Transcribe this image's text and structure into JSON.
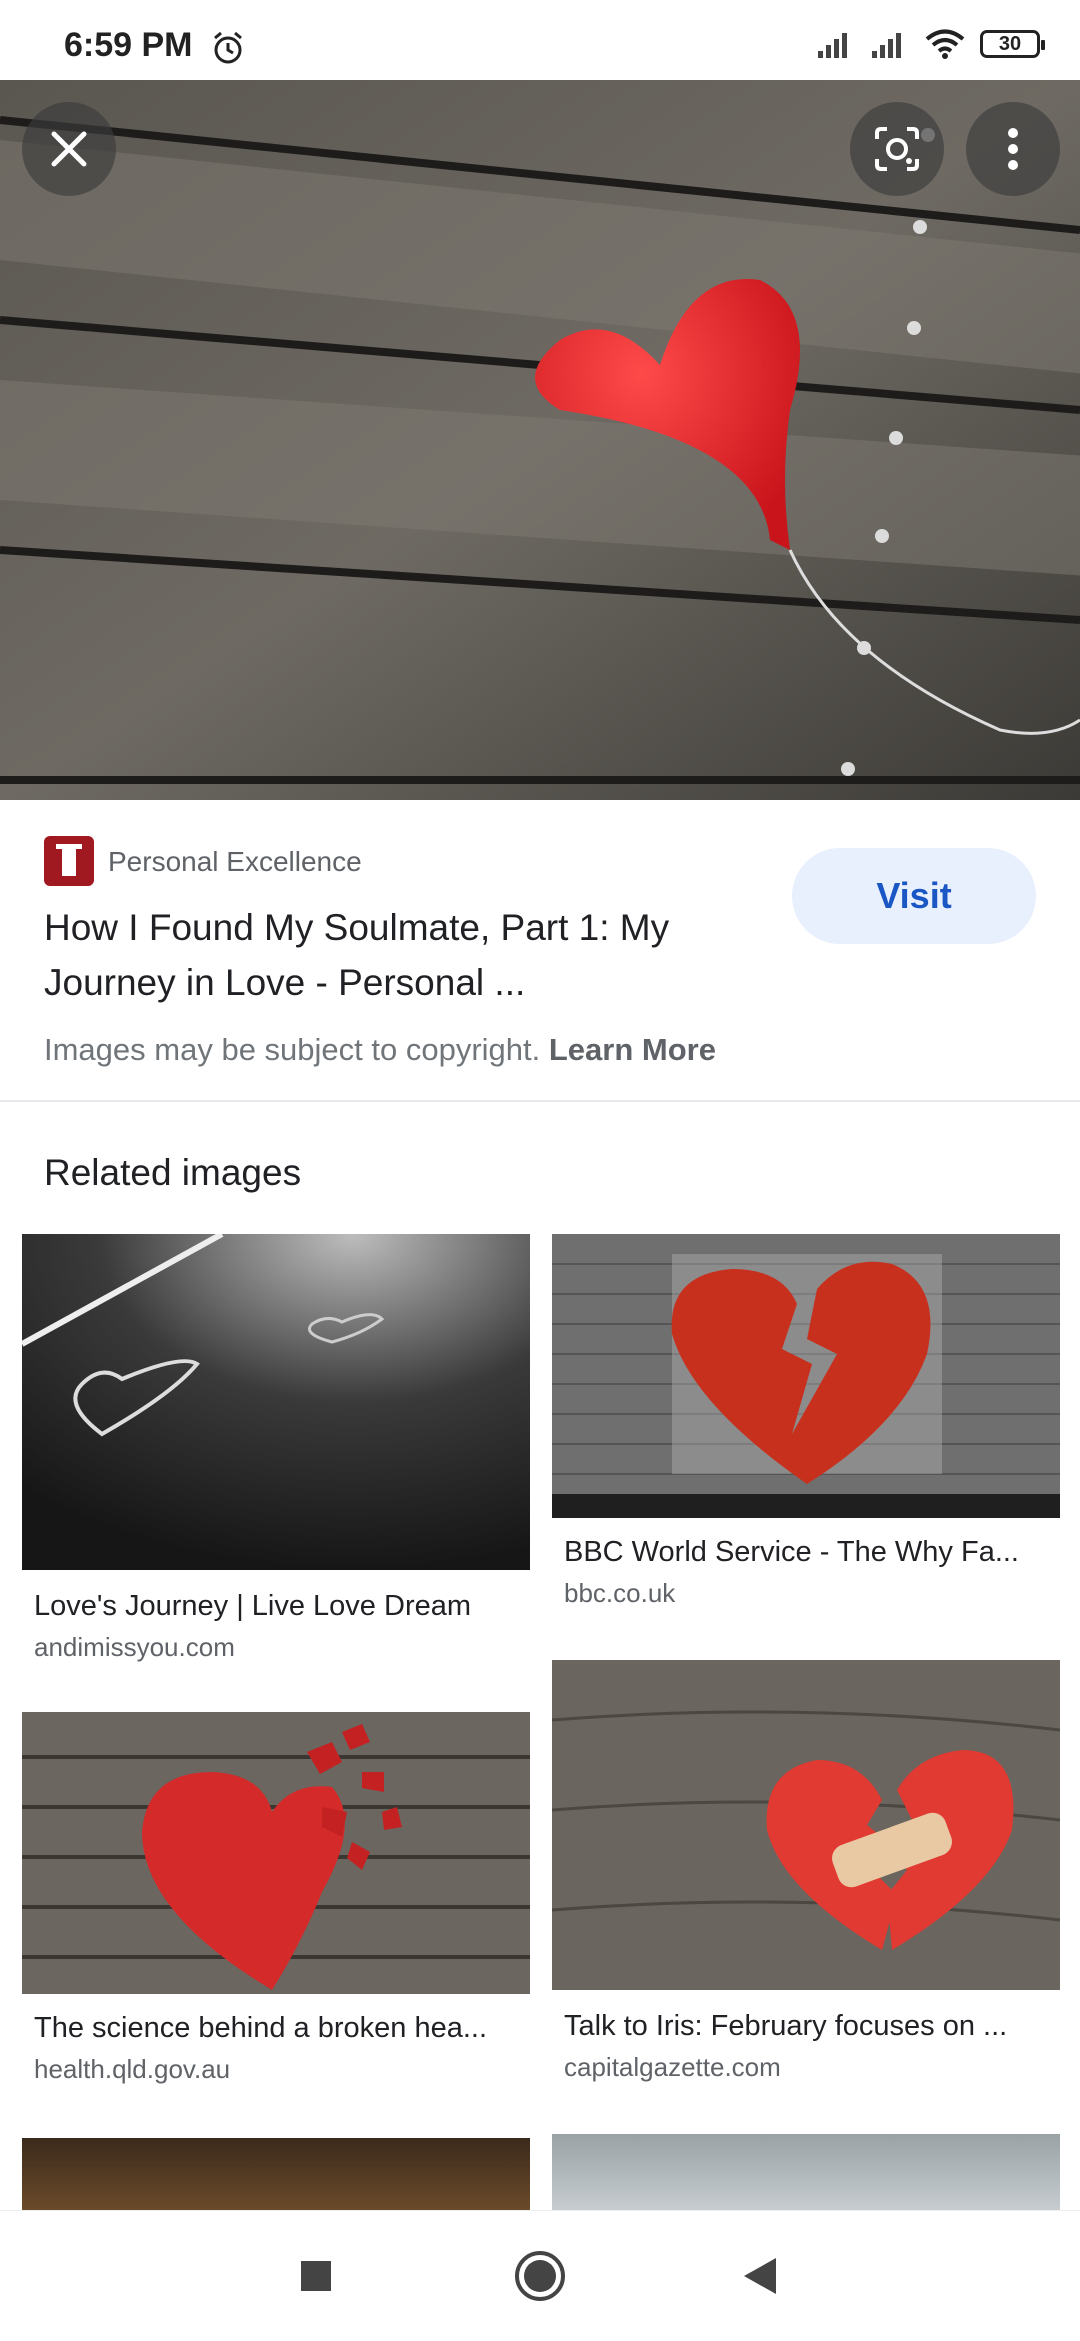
{
  "status_bar": {
    "time": "6:59 PM",
    "battery": "30"
  },
  "source": {
    "site_name": "Personal Excellence",
    "title": "How I Found My Soulmate, Part 1: My Journey in Love - Personal ...",
    "visit_label": "Visit",
    "copyright_text": "Images may be subject to copyright.",
    "learn_more_label": "Learn More"
  },
  "related": {
    "heading": "Related images",
    "items": [
      {
        "title": "Love's Journey | Live Love Dream",
        "domain": "andimissyou.com"
      },
      {
        "title": "BBC World Service - The Why Fa...",
        "domain": "bbc.co.uk"
      },
      {
        "title": "The science behind a broken hea...",
        "domain": "health.qld.gov.au"
      },
      {
        "title": "Talk to Iris: February focuses on ...",
        "domain": "capitalgazette.com"
      }
    ]
  },
  "colors": {
    "accent": "#1a57c4",
    "visit_bg": "#e8f0fe",
    "heart_red": "#e0262b"
  }
}
